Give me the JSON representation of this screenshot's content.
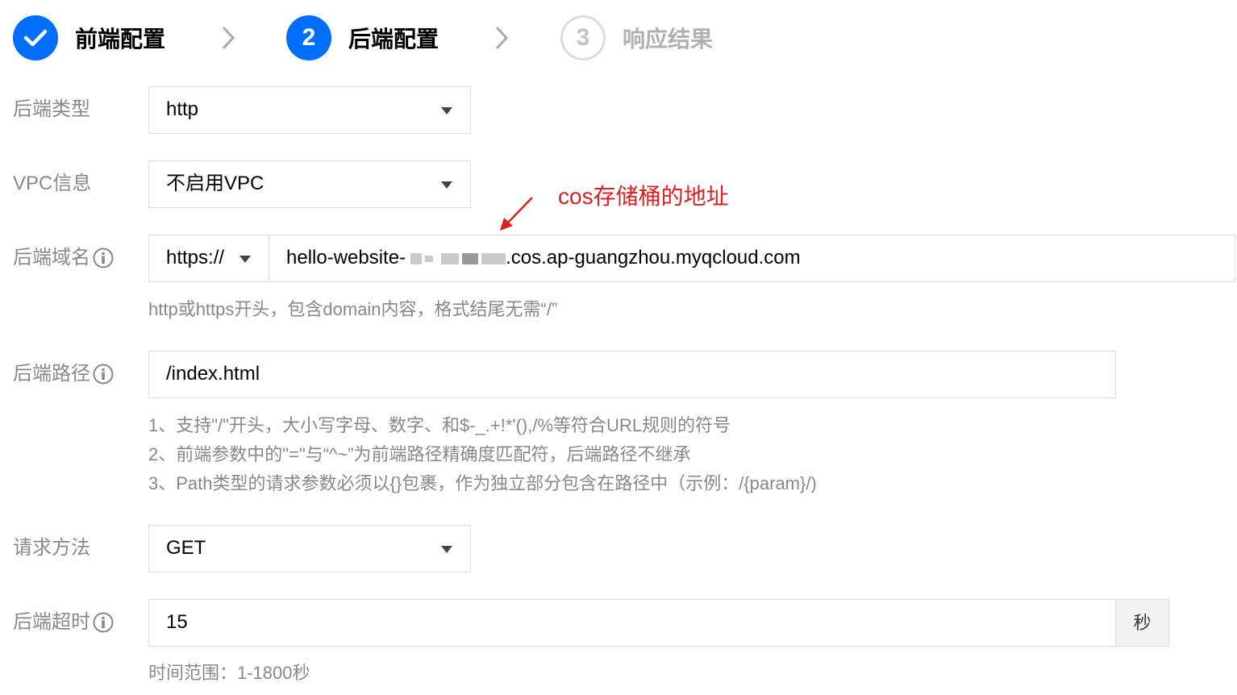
{
  "steps": [
    {
      "label": "前端配置",
      "state": "done"
    },
    {
      "label": "后端配置",
      "number": "2",
      "state": "active"
    },
    {
      "label": "响应结果",
      "number": "3",
      "state": "pending"
    }
  ],
  "form": {
    "backend_type": {
      "label": "后端类型",
      "value": "http"
    },
    "vpc": {
      "label": "VPC信息",
      "value": "不启用VPC"
    },
    "domain": {
      "label": "后端域名",
      "protocol": "https://",
      "value_prefix": "hello-website-",
      "value_suffix": ".cos.ap-guangzhou.myqcloud.com",
      "help": "http或https开头，包含domain内容，格式结尾无需“/”"
    },
    "path": {
      "label": "后端路径",
      "value": "/index.html",
      "help": [
        "1、支持\"/\"开头，大小写字母、数字、和$-_.+!*'(),/%等符合URL规则的符号",
        "2、前端参数中的\"=\"与“^~”为前端路径精确度匹配符，后端路径不继承",
        "3、Path类型的请求参数必须以{}包裹，作为独立部分包含在路径中（示例：/{param}/)"
      ]
    },
    "method": {
      "label": "请求方法",
      "value": "GET"
    },
    "timeout": {
      "label": "后端超时",
      "value": "15",
      "unit": "秒",
      "help": "时间范围：1-1800秒"
    }
  },
  "annotation": {
    "text": "cos存储桶的地址",
    "color": "#e02020"
  },
  "colors": {
    "primary": "#006eff",
    "border": "#dcdcdc",
    "muted": "#888888"
  }
}
